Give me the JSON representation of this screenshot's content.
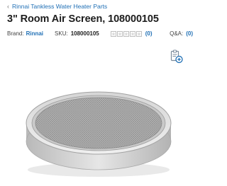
{
  "breadcrumb": {
    "label": "Rinnai Tankless Water Heater Parts"
  },
  "product": {
    "title": "3\" Room Air Screen, 108000105",
    "brand_label": "Brand:",
    "brand_name": "Rinnai",
    "sku_label": "SKU:",
    "sku_value": "108000105",
    "rating": 0,
    "review_count": "(0)",
    "qa_label": "Q&A:",
    "qa_count": "(0)"
  },
  "colors": {
    "link": "#1f6fb5",
    "title": "#1d1d1d",
    "star_border": "#bfbfbf"
  },
  "icons": {
    "breadcrumb": "chevron-left-icon",
    "compare": "compare-add-icon",
    "rating": "star-icon"
  }
}
